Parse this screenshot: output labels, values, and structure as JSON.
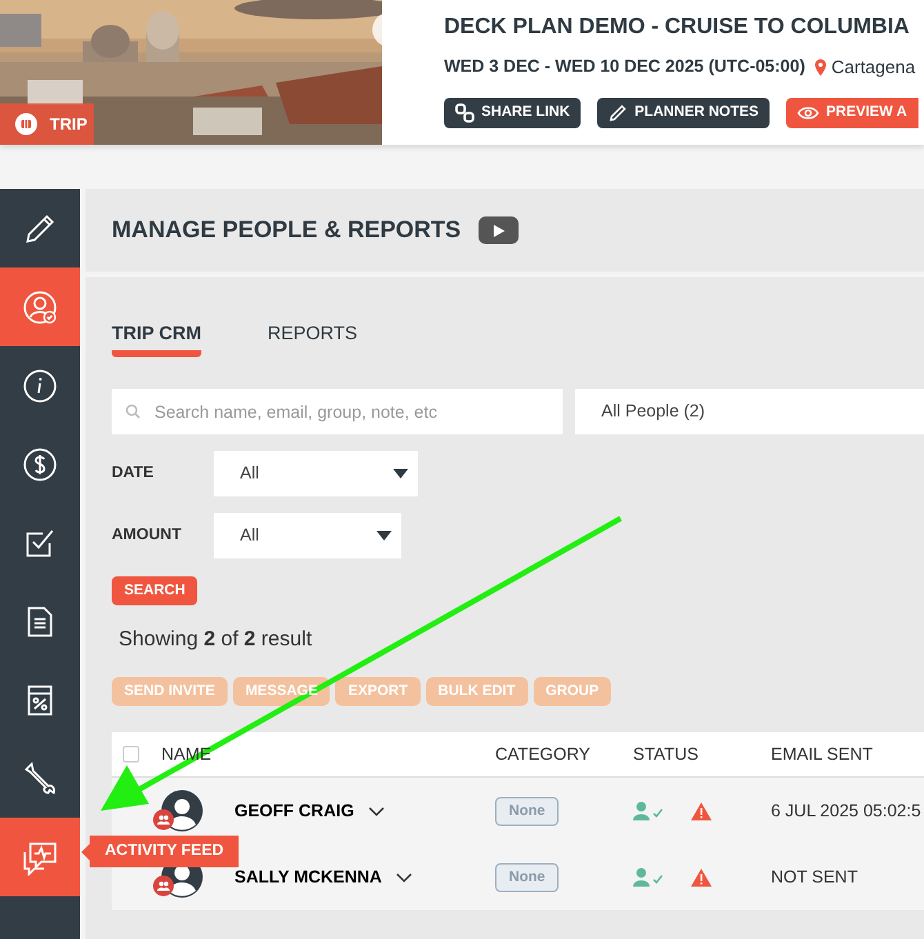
{
  "trip": {
    "badge": "TRIP",
    "title": "DECK PLAN DEMO - CRUISE TO COLUMBIA",
    "dates": "WED 3 DEC - WED 10 DEC 2025 (UTC-05:00)",
    "location": "Cartagena",
    "actions": [
      {
        "label": "SHARE LINK",
        "kind": "link"
      },
      {
        "label": "PLANNER NOTES",
        "kind": "notes"
      },
      {
        "label": "PREVIEW A",
        "kind": "preview"
      }
    ]
  },
  "sidebar": {
    "items": [
      {
        "highlighted": false
      },
      {
        "highlighted": true
      },
      {
        "highlighted": false
      },
      {
        "highlighted": false
      },
      {
        "highlighted": false
      },
      {
        "highlighted": false
      },
      {
        "highlighted": false
      },
      {
        "highlighted": false
      },
      {
        "highlighted": true,
        "tooltip": "ACTIVITY FEED"
      }
    ]
  },
  "page": {
    "title": "MANAGE PEOPLE & REPORTS",
    "tabs": [
      {
        "label": "TRIP CRM",
        "selected": true
      },
      {
        "label": "REPORTS",
        "selected": false
      }
    ],
    "search": {
      "placeholder": "Search name, email, group, note, etc"
    },
    "people_filter": "All People (2)",
    "filters": [
      {
        "label": "DATE",
        "value": "All"
      },
      {
        "label": "AMOUNT",
        "value": "All"
      }
    ],
    "search_button": "SEARCH",
    "summary": "Showing **2** of **2** result",
    "bulk_actions": [
      {
        "label": "SEND INVITE",
        "disabled": true
      },
      {
        "label": "MESSAGE",
        "disabled": true
      },
      {
        "label": "EXPORT",
        "disabled": true
      },
      {
        "label": "BULK EDIT",
        "disabled": true
      },
      {
        "label": "GROUP",
        "disabled": true
      }
    ],
    "table": {
      "select_all": {
        "checked": false
      },
      "columns": [
        "NAME",
        "CATEGORY",
        "STATUS",
        "EMAIL SENT"
      ],
      "rows": [
        {
          "name": "GEOFF CRAIG",
          "category": "None",
          "email_sent": "6 JUL 2025 05:02:5"
        },
        {
          "name": "SALLY MCKENNA",
          "category": "None",
          "email_sent": "NOT SENT"
        }
      ]
    }
  }
}
